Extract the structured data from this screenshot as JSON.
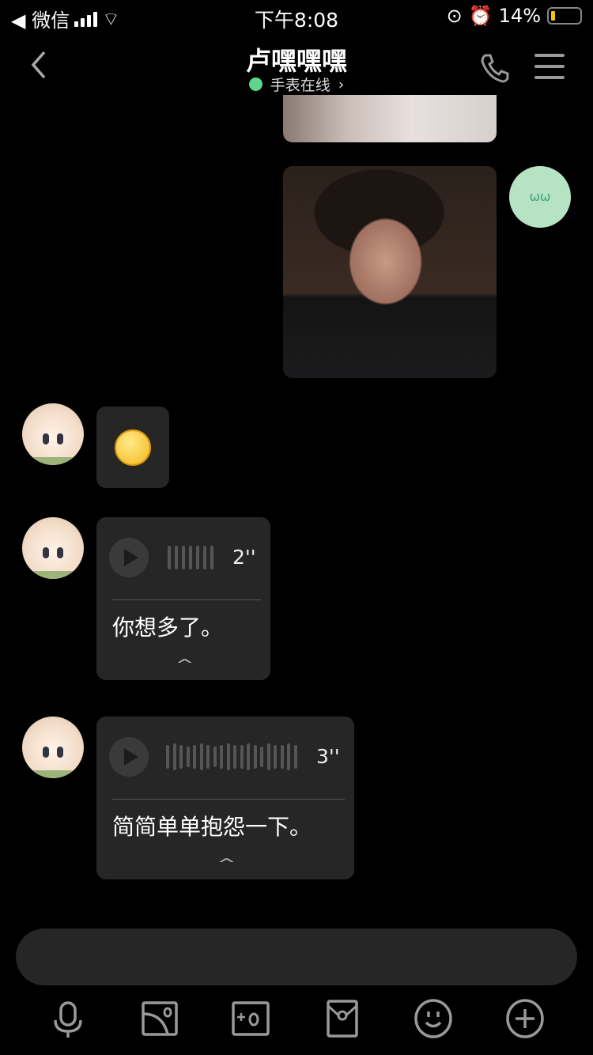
{
  "status_bar": {
    "back_app": "◀ 微信",
    "time": "下午8:08",
    "battery": "14%",
    "battery_level": 0.14
  },
  "header": {
    "title": "卢嘿嘿嘿",
    "status": "手表在线",
    "status_chevron": "›",
    "status_color": "#5fd68a"
  },
  "messages": [
    {
      "type": "image",
      "side": "right"
    },
    {
      "type": "image",
      "side": "right"
    },
    {
      "type": "emoji",
      "side": "left",
      "emoji": "smile"
    },
    {
      "type": "voice",
      "side": "left",
      "duration": "2''",
      "transcript": "你想多了。",
      "collapse": "^"
    },
    {
      "type": "voice",
      "side": "left",
      "duration": "3''",
      "transcript": "简简单单抱怨一下。",
      "collapse": "^"
    }
  ],
  "right_avatar_text": "ѡѡ",
  "toolbar": [
    "mic-icon",
    "image-icon",
    "camera-icon",
    "red-packet-icon",
    "emoji-icon",
    "plus-icon"
  ]
}
